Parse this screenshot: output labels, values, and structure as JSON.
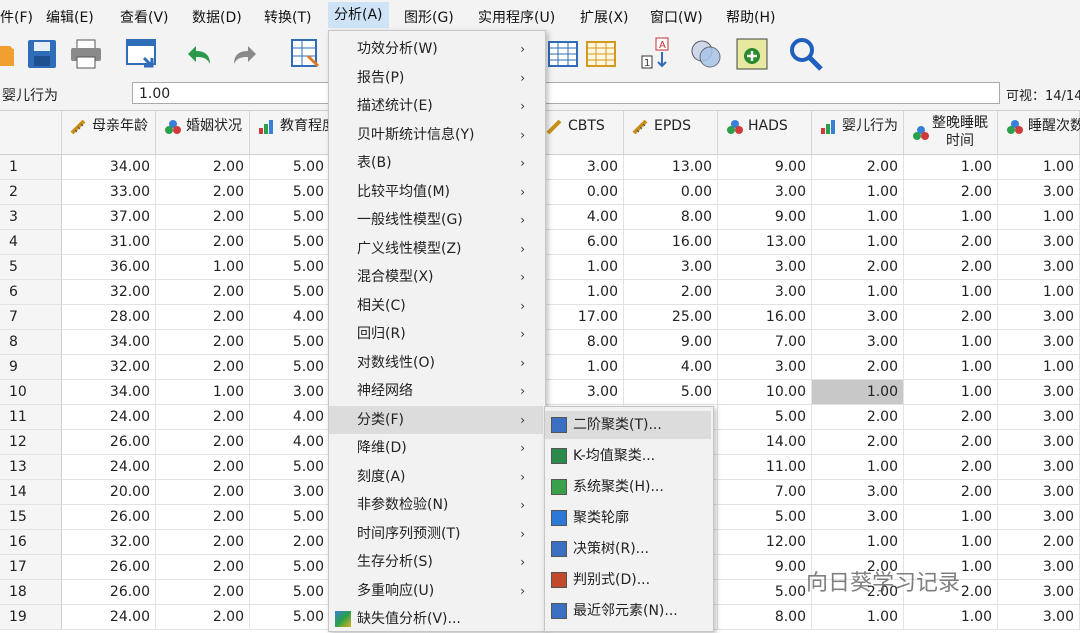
{
  "menubar": {
    "items": [
      "件(F)",
      "编辑(E)",
      "查看(V)",
      "数据(D)",
      "转换(T)",
      "分析(A)",
      "图形(G)",
      "实用程序(U)",
      "扩展(X)",
      "窗口(W)",
      "帮助(H)"
    ]
  },
  "varbar": {
    "name": "婴儿行为",
    "value": "1.00",
    "visible": "可视：14/14"
  },
  "columns": [
    "母亲年龄",
    "婚姻状况",
    "教育程度",
    "CBTS",
    "EPDS",
    "HADS",
    "婴儿行为",
    "整晚睡眠\n时间",
    "睡醒次数"
  ],
  "rows": [
    {
      "n": "1",
      "c": [
        "34.00",
        "2.00",
        "5.00",
        "3.00",
        "13.00",
        "9.00",
        "2.00",
        "1.00",
        "1.00"
      ]
    },
    {
      "n": "2",
      "c": [
        "33.00",
        "2.00",
        "5.00",
        "0.00",
        "0.00",
        "3.00",
        "1.00",
        "2.00",
        "3.00"
      ]
    },
    {
      "n": "3",
      "c": [
        "37.00",
        "2.00",
        "5.00",
        "4.00",
        "8.00",
        "9.00",
        "1.00",
        "1.00",
        "1.00"
      ]
    },
    {
      "n": "4",
      "c": [
        "31.00",
        "2.00",
        "5.00",
        "6.00",
        "16.00",
        "13.00",
        "1.00",
        "2.00",
        "3.00"
      ]
    },
    {
      "n": "5",
      "c": [
        "36.00",
        "1.00",
        "5.00",
        "1.00",
        "3.00",
        "3.00",
        "2.00",
        "2.00",
        "3.00"
      ]
    },
    {
      "n": "6",
      "c": [
        "32.00",
        "2.00",
        "5.00",
        "1.00",
        "2.00",
        "3.00",
        "1.00",
        "1.00",
        "1.00"
      ]
    },
    {
      "n": "7",
      "c": [
        "28.00",
        "2.00",
        "4.00",
        "17.00",
        "25.00",
        "16.00",
        "3.00",
        "2.00",
        "3.00"
      ]
    },
    {
      "n": "8",
      "c": [
        "34.00",
        "2.00",
        "5.00",
        "8.00",
        "9.00",
        "7.00",
        "3.00",
        "1.00",
        "3.00"
      ]
    },
    {
      "n": "9",
      "c": [
        "32.00",
        "2.00",
        "5.00",
        "1.00",
        "4.00",
        "3.00",
        "2.00",
        "1.00",
        "1.00"
      ]
    },
    {
      "n": "10",
      "c": [
        "34.00",
        "1.00",
        "3.00",
        "3.00",
        "5.00",
        "10.00",
        "1.00",
        "1.00",
        "3.00"
      ]
    },
    {
      "n": "11",
      "c": [
        "24.00",
        "2.00",
        "4.00",
        "",
        "",
        "5.00",
        "2.00",
        "2.00",
        "3.00"
      ]
    },
    {
      "n": "12",
      "c": [
        "26.00",
        "2.00",
        "4.00",
        "",
        "",
        "14.00",
        "2.00",
        "2.00",
        "3.00"
      ]
    },
    {
      "n": "13",
      "c": [
        "24.00",
        "2.00",
        "5.00",
        "",
        "",
        "11.00",
        "1.00",
        "2.00",
        "3.00"
      ]
    },
    {
      "n": "14",
      "c": [
        "20.00",
        "2.00",
        "3.00",
        "",
        "",
        "7.00",
        "3.00",
        "2.00",
        "3.00"
      ]
    },
    {
      "n": "15",
      "c": [
        "26.00",
        "2.00",
        "5.00",
        "",
        "",
        "5.00",
        "3.00",
        "1.00",
        "3.00"
      ]
    },
    {
      "n": "16",
      "c": [
        "32.00",
        "2.00",
        "2.00",
        "",
        "",
        "12.00",
        "1.00",
        "1.00",
        "2.00"
      ]
    },
    {
      "n": "17",
      "c": [
        "26.00",
        "2.00",
        "5.00",
        "",
        "",
        "9.00",
        "2.00",
        "1.00",
        "3.00"
      ]
    },
    {
      "n": "18",
      "c": [
        "26.00",
        "2.00",
        "5.00",
        "",
        "",
        "5.00",
        "2.00",
        "2.00",
        "3.00"
      ]
    },
    {
      "n": "19",
      "c": [
        "24.00",
        "2.00",
        "5.00",
        "",
        "",
        "8.00",
        "1.00",
        "1.00",
        "3.00"
      ]
    }
  ],
  "analyze_menu": {
    "items": [
      {
        "label": "功效分析(W)",
        "arrow": "›"
      },
      {
        "label": "报告(P)",
        "arrow": "›"
      },
      {
        "label": "描述统计(E)",
        "arrow": "›"
      },
      {
        "label": "贝叶斯统计信息(Y)",
        "arrow": "›"
      },
      {
        "label": "表(B)",
        "arrow": "›"
      },
      {
        "label": "比较平均值(M)",
        "arrow": "›"
      },
      {
        "label": "一般线性模型(G)",
        "arrow": "›"
      },
      {
        "label": "广义线性模型(Z)",
        "arrow": "›"
      },
      {
        "label": "混合模型(X)",
        "arrow": "›"
      },
      {
        "label": "相关(C)",
        "arrow": "›"
      },
      {
        "label": "回归(R)",
        "arrow": "›"
      },
      {
        "label": "对数线性(O)",
        "arrow": "›"
      },
      {
        "label": "神经网络",
        "arrow": "›"
      },
      {
        "label": "分类(F)",
        "arrow": "›"
      },
      {
        "label": "降维(D)",
        "arrow": "›"
      },
      {
        "label": "刻度(A)",
        "arrow": "›"
      },
      {
        "label": "非参数检验(N)",
        "arrow": "›"
      },
      {
        "label": "时间序列预测(T)",
        "arrow": "›"
      },
      {
        "label": "生存分析(S)",
        "arrow": "›"
      },
      {
        "label": "多重响应(U)",
        "arrow": "›"
      },
      {
        "label": "缺失值分析(V)...",
        "arrow": ""
      }
    ]
  },
  "classify_menu": {
    "items": [
      {
        "label": "二阶聚类(T)...",
        "icon": "twostep-cluster-icon",
        "color": "#3a6fc4"
      },
      {
        "label": "K-均值聚类...",
        "icon": "kmeans-cluster-icon",
        "color": "#2a8a4a"
      },
      {
        "label": "系统聚类(H)...",
        "icon": "hierarchical-cluster-icon",
        "color": "#3aa04a"
      },
      {
        "label": "聚类轮廓",
        "icon": "cluster-silhouette-icon",
        "color": "#2b78d6"
      },
      {
        "label": "决策树(R)...",
        "icon": "decision-tree-icon",
        "color": "#3a6fc4"
      },
      {
        "label": "判别式(D)...",
        "icon": "discriminant-icon",
        "color": "#c04a2a"
      },
      {
        "label": "最近邻元素(N)...",
        "icon": "nearest-neighbor-icon",
        "color": "#3a6fc4"
      }
    ]
  },
  "watermark": "向日葵学习记录"
}
